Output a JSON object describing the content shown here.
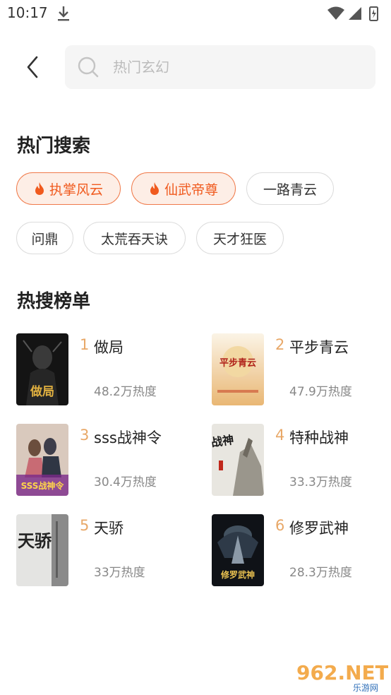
{
  "status": {
    "time": "10:17"
  },
  "search": {
    "placeholder": "热门玄幻"
  },
  "hot_search": {
    "title": "热门搜索",
    "tags": [
      {
        "label": "执掌风云",
        "hot": true
      },
      {
        "label": "仙武帝尊",
        "hot": true
      },
      {
        "label": "一路青云",
        "hot": false
      },
      {
        "label": "问鼎",
        "hot": false
      },
      {
        "label": "太荒吞天诀",
        "hot": false
      },
      {
        "label": "天才狂医",
        "hot": false
      }
    ]
  },
  "ranking": {
    "title": "热搜榜单",
    "items": [
      {
        "rank": "1",
        "title": "做局",
        "heat": "48.2万热度",
        "cover_text": "做局"
      },
      {
        "rank": "2",
        "title": "平步青云",
        "heat": "47.9万热度",
        "cover_text": "平步青云"
      },
      {
        "rank": "3",
        "title": "sss战神令",
        "heat": "30.4万热度",
        "cover_text": "SSS战神令"
      },
      {
        "rank": "4",
        "title": "特种战神",
        "heat": "33.3万热度",
        "cover_text": "战神"
      },
      {
        "rank": "5",
        "title": "天骄",
        "heat": "33万热度",
        "cover_text": "天骄"
      },
      {
        "rank": "6",
        "title": "修罗武神",
        "heat": "28.3万热度",
        "cover_text": "修罗武神"
      }
    ]
  },
  "watermark": {
    "text": "962.NET",
    "sub": "乐游网"
  },
  "colors": {
    "accent": "#f05a1e",
    "hot_bg": "#fdeee6",
    "rank_num": "#e8a868"
  }
}
